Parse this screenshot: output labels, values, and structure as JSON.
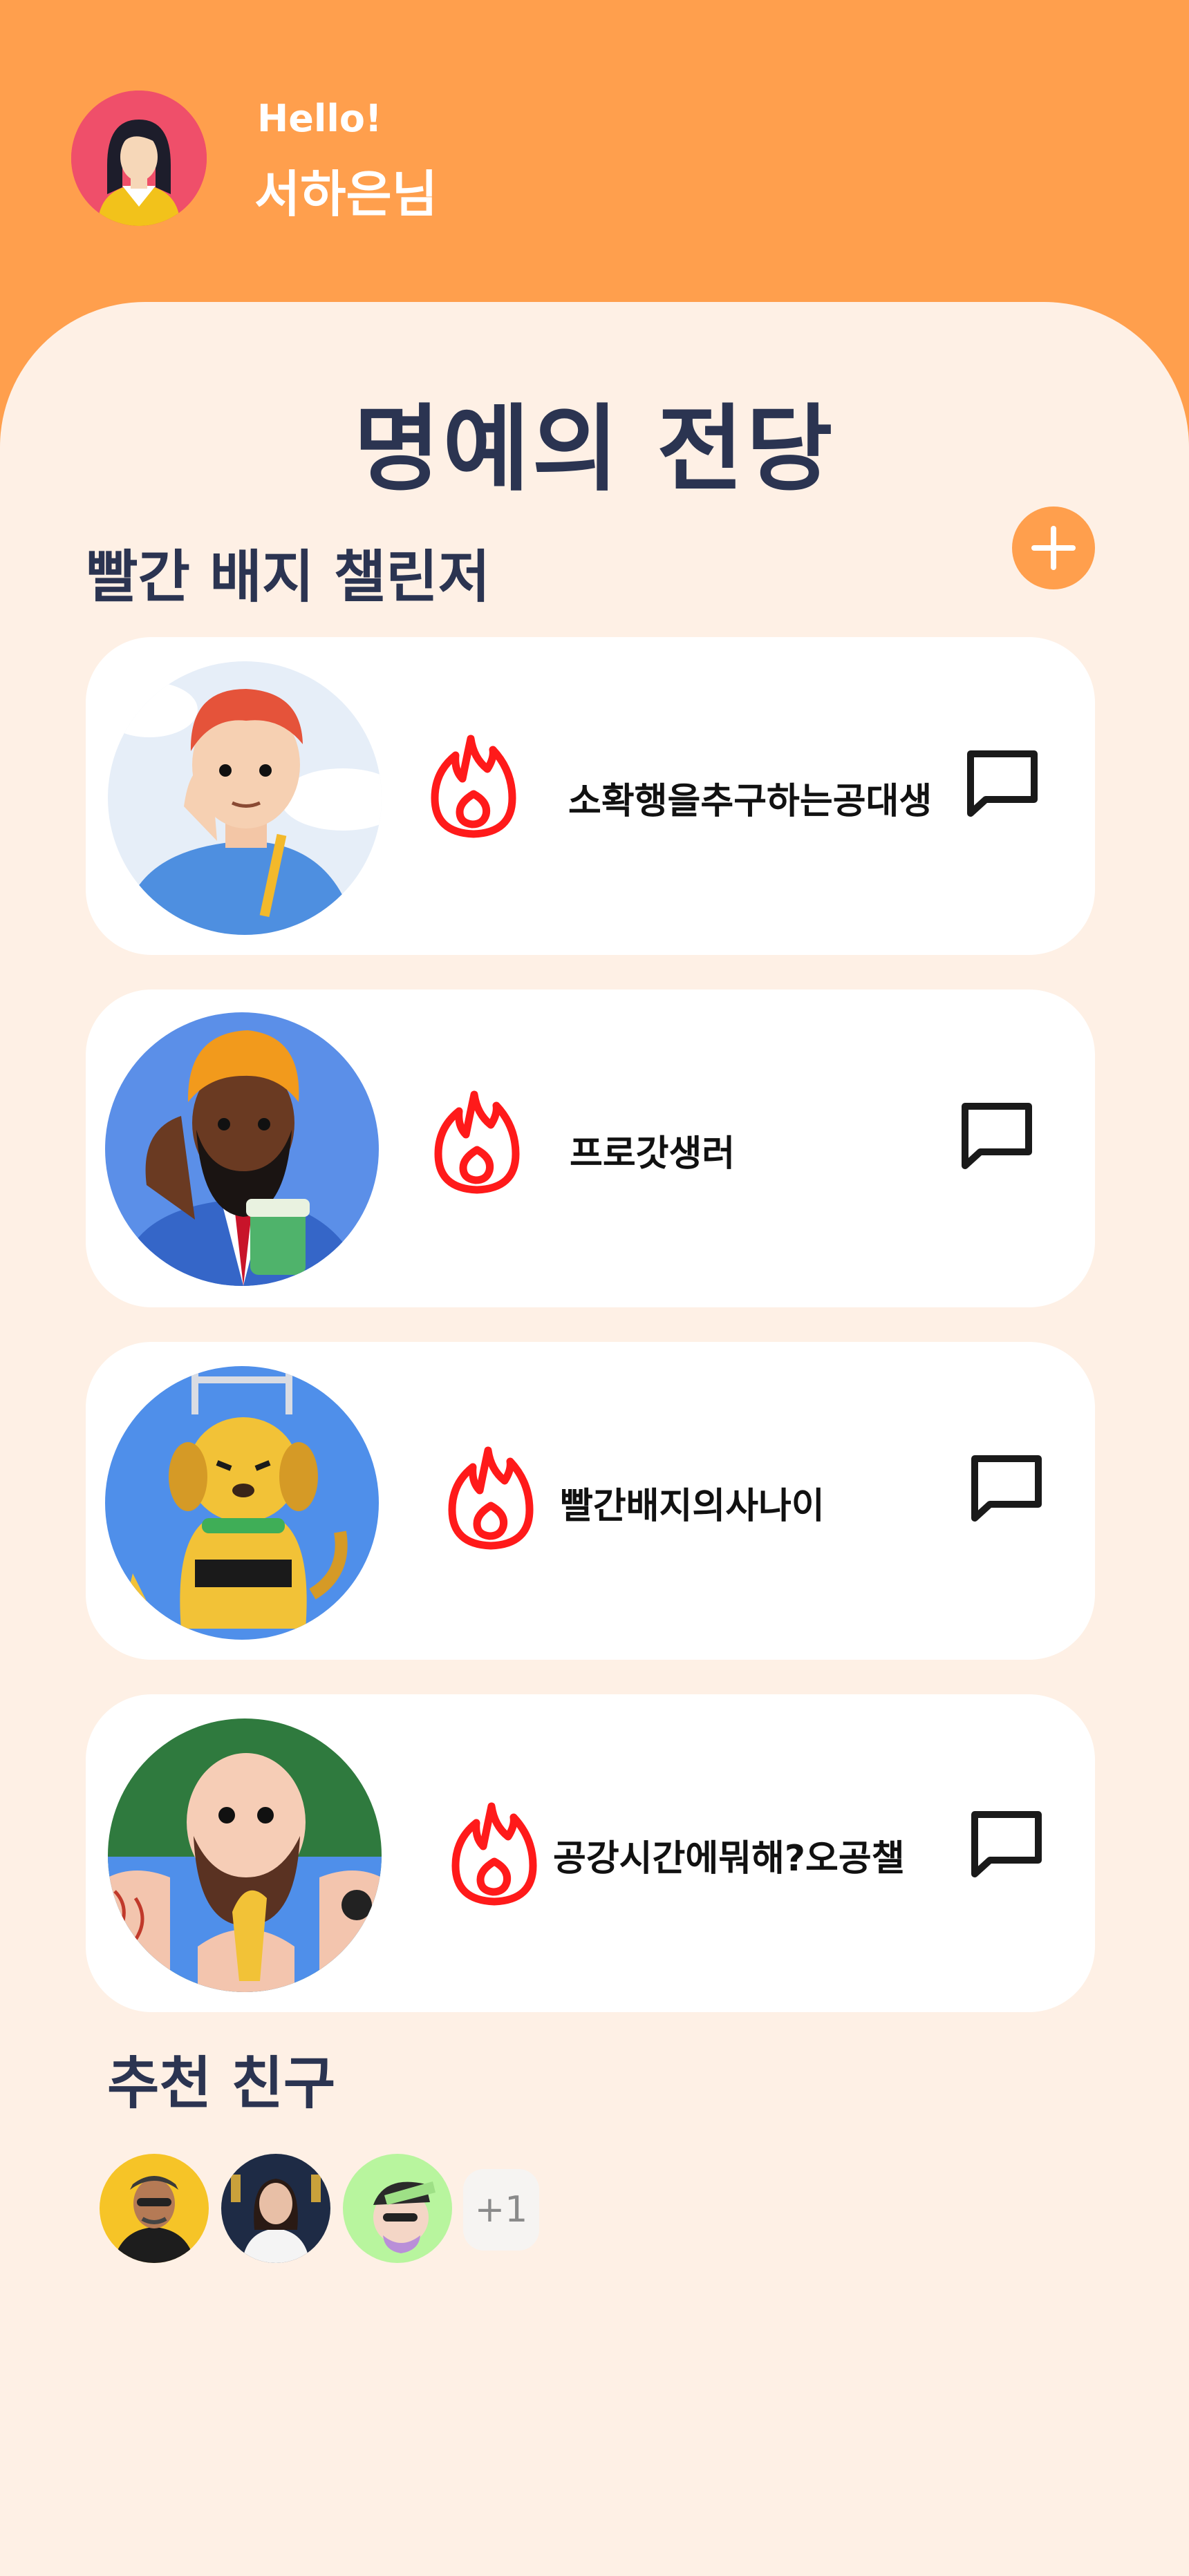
{
  "header": {
    "greeting": "Hello!",
    "user_name": "서하은님"
  },
  "page_title": "명예의 전당",
  "challengers": {
    "title": "빨간 배지 챌린저",
    "add_icon": "plus-icon",
    "items": [
      {
        "name": "소확행을추구하는공대생",
        "badge_icon": "flame-icon",
        "action_icon": "chat-icon"
      },
      {
        "name": "프로갓생러",
        "badge_icon": "flame-icon",
        "action_icon": "chat-icon"
      },
      {
        "name": "빨간배지의사나이",
        "badge_icon": "flame-icon",
        "action_icon": "chat-icon"
      },
      {
        "name": "공강시간에뭐해?오공챌",
        "badge_icon": "flame-icon",
        "action_icon": "chat-icon"
      }
    ]
  },
  "recommended": {
    "title": "추천 친구",
    "more_count": "+1"
  },
  "colors": {
    "accent": "#FF9F4D",
    "background": "#FEF0E5",
    "title_text": "#2B3451",
    "badge_red": "#FF1A1A"
  }
}
